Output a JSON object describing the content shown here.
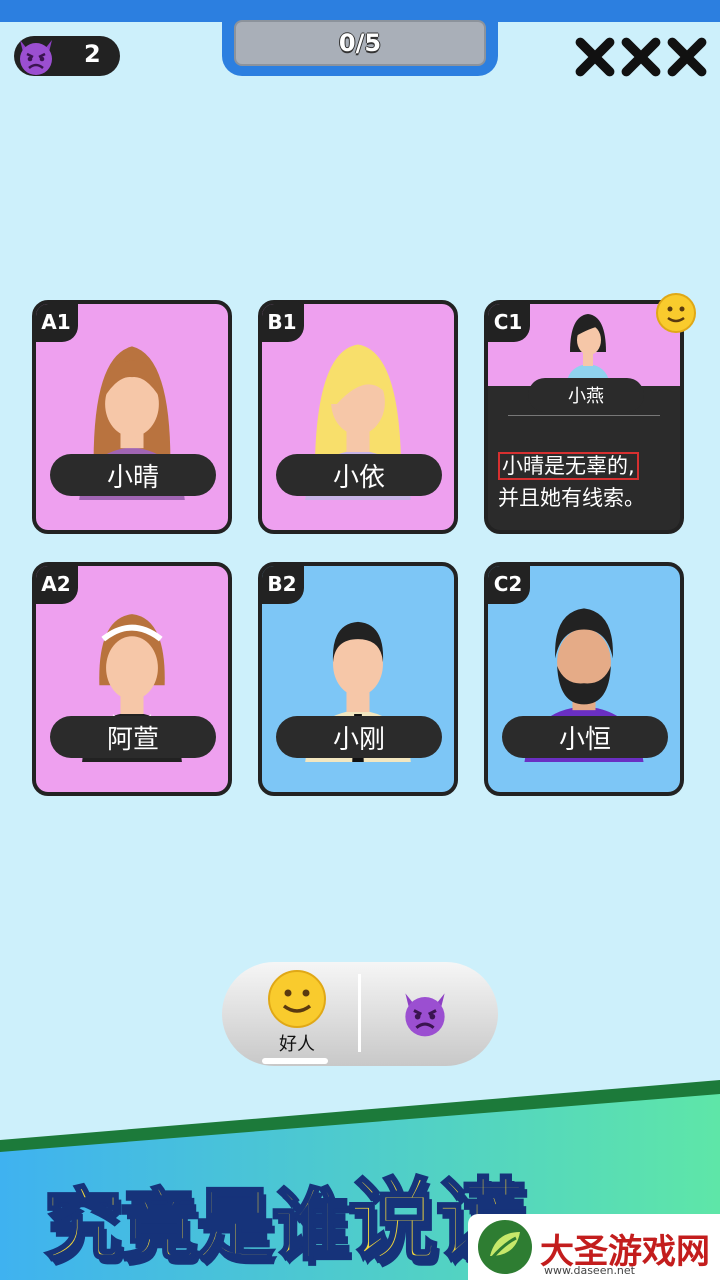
{
  "header": {
    "progress_text": "0/5",
    "devil_count": "2",
    "devil_icon": "devil-emoji-icon",
    "lives": [
      "x-mark-icon",
      "x-mark-icon",
      "x-mark-icon"
    ]
  },
  "cards": [
    {
      "id": "A1",
      "name": "小晴",
      "color": "#eea0ef"
    },
    {
      "id": "B1",
      "name": "小依",
      "color": "#eea0ef"
    },
    {
      "id": "C1",
      "name": "小燕",
      "color": "#eea0ef",
      "statement_highlight": "小晴是无辜的,",
      "statement_rest": "并且她有线索。",
      "badge_icon": "smiley-icon"
    },
    {
      "id": "A2",
      "name": "阿萱",
      "color": "#eea0ef"
    },
    {
      "id": "B2",
      "name": "小刚",
      "color": "#7dc6f6"
    },
    {
      "id": "C2",
      "name": "小恒",
      "color": "#7dc6f6"
    }
  ],
  "chooser": {
    "good_label": "好人",
    "good_icon": "smiley-icon",
    "bad_icon": "devil-emoji-icon"
  },
  "banner": {
    "title_part1": "究竟是谁",
    "title_part2": "说谎"
  },
  "watermark": {
    "text": "大圣游戏网",
    "url": "www.daseen.net"
  }
}
